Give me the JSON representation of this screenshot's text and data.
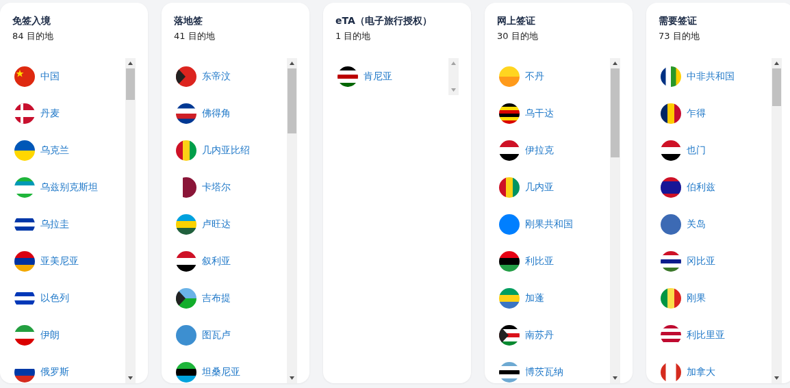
{
  "columns": [
    {
      "title": "免签入境",
      "count": "84 目的地",
      "items": [
        {
          "name": "中国"
        },
        {
          "name": "丹麦"
        },
        {
          "name": "乌克兰"
        },
        {
          "name": "乌兹别克斯坦"
        },
        {
          "name": "乌拉圭"
        },
        {
          "name": "亚美尼亚"
        },
        {
          "name": "以色列"
        },
        {
          "name": "伊朗"
        },
        {
          "name": "俄罗斯"
        }
      ]
    },
    {
      "title": "落地签",
      "count": "41 目的地",
      "items": [
        {
          "name": "东帝汶"
        },
        {
          "name": "佛得角"
        },
        {
          "name": "几内亚比绍"
        },
        {
          "name": "卡塔尔"
        },
        {
          "name": "卢旺达"
        },
        {
          "name": "叙利亚"
        },
        {
          "name": "吉布提"
        },
        {
          "name": "图瓦卢"
        },
        {
          "name": "坦桑尼亚"
        }
      ]
    },
    {
      "title": "eTA（电子旅行授权）",
      "count": "1 目的地",
      "items": [
        {
          "name": "肯尼亚"
        }
      ]
    },
    {
      "title": "网上签证",
      "count": "30 目的地",
      "items": [
        {
          "name": "不丹"
        },
        {
          "name": "乌干达"
        },
        {
          "name": "伊拉克"
        },
        {
          "name": "几内亚"
        },
        {
          "name": "刚果共和国"
        },
        {
          "name": "利比亚"
        },
        {
          "name": "加蓬"
        },
        {
          "name": "南苏丹"
        },
        {
          "name": "博茨瓦纳"
        }
      ]
    },
    {
      "title": "需要签证",
      "count": "73 目的地",
      "items": [
        {
          "name": "中非共和国"
        },
        {
          "name": "乍得"
        },
        {
          "name": "也门"
        },
        {
          "name": "伯利兹"
        },
        {
          "name": "关岛"
        },
        {
          "name": "冈比亚"
        },
        {
          "name": "刚果"
        },
        {
          "name": "利比里亚"
        },
        {
          "name": "加拿大"
        }
      ]
    }
  ]
}
